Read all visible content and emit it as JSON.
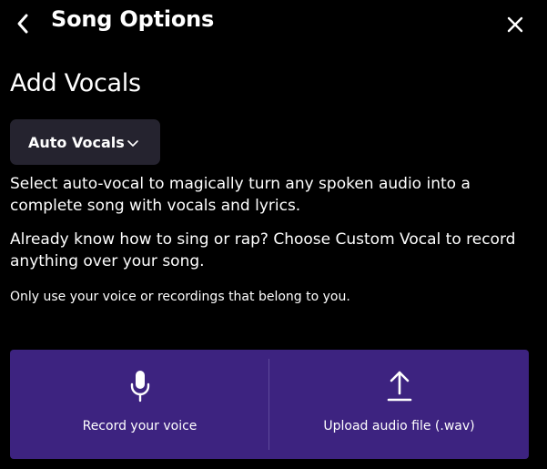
{
  "header": {
    "title": "Song Options",
    "back_icon": "chevron-left-icon",
    "close_icon": "close-icon"
  },
  "section": {
    "title": "Add Vocals"
  },
  "dropdown": {
    "selected": "Auto Vocals",
    "icon": "chevron-down-icon"
  },
  "descriptions": {
    "auto_vocal": "Select auto-vocal to magically turn any spoken audio into a complete song with vocals and lyrics.",
    "custom_vocal": "Already know how to sing or rap? Choose Custom Vocal to record anything over your song.",
    "note": "Only use your voice or recordings that belong to you."
  },
  "actions": {
    "record": {
      "label": "Record your voice",
      "icon": "microphone-icon"
    },
    "upload": {
      "label": "Upload audio file (.wav)",
      "icon": "upload-icon"
    }
  },
  "colors": {
    "background": "#000000",
    "dropdown_bg": "#25232f",
    "actions_bg": "#3d2380",
    "divider": "#5e4a9b",
    "text": "#ffffff"
  }
}
